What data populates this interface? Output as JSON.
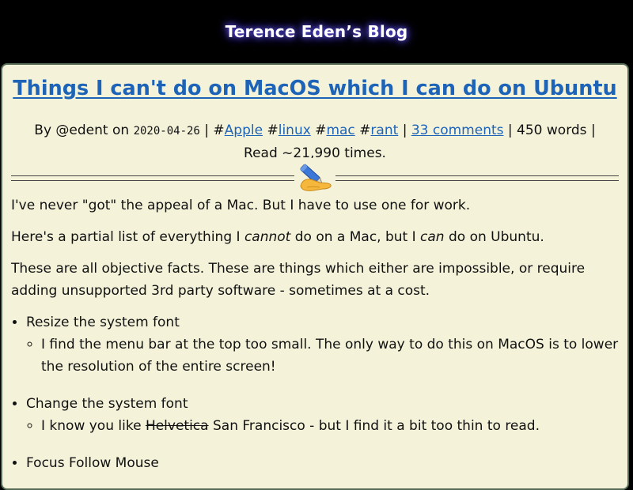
{
  "header": {
    "site_title": "Terence Eden’s Blog"
  },
  "post": {
    "title": "Things I can't do on MacOS which I can do on Ubuntu",
    "meta": {
      "by_label": "By @edent on",
      "date": "2020-04-26",
      "tags": [
        "Apple",
        "linux",
        "mac",
        "rant"
      ],
      "comments": "33 comments",
      "words": "450 words",
      "reads": "Read ~21,990 times."
    },
    "body": {
      "p1": "I've never \"got\" the appeal of a Mac. But I have to use one for work.",
      "p2_a": "Here's a partial list of everything I ",
      "p2_em1": "cannot",
      "p2_b": " do on a Mac, but I ",
      "p2_em2": "can",
      "p2_c": " do on Ubuntu.",
      "p3": "These are all objective facts. These are things which either are impossible, or require adding unsupported 3rd party software - sometimes at a cost.",
      "list": [
        {
          "label": "Resize the system font",
          "sub": "I find the menu bar at the top too small. The only way to do this on MacOS is to lower the resolution of the entire screen!"
        },
        {
          "label": "Change the system font",
          "sub_strike": "Helvetica",
          "sub_rest": " San Francisco - but I find it a bit too thin to read.",
          "sub_prefix": "I know you like "
        },
        {
          "label": "Focus Follow Mouse"
        }
      ]
    }
  },
  "colors": {
    "background": "#000000",
    "article_bg": "#f4f3da",
    "link": "#1d63b8",
    "title_glow": "#6a5cff"
  },
  "icons": {
    "divider": "writing-hand-icon"
  }
}
